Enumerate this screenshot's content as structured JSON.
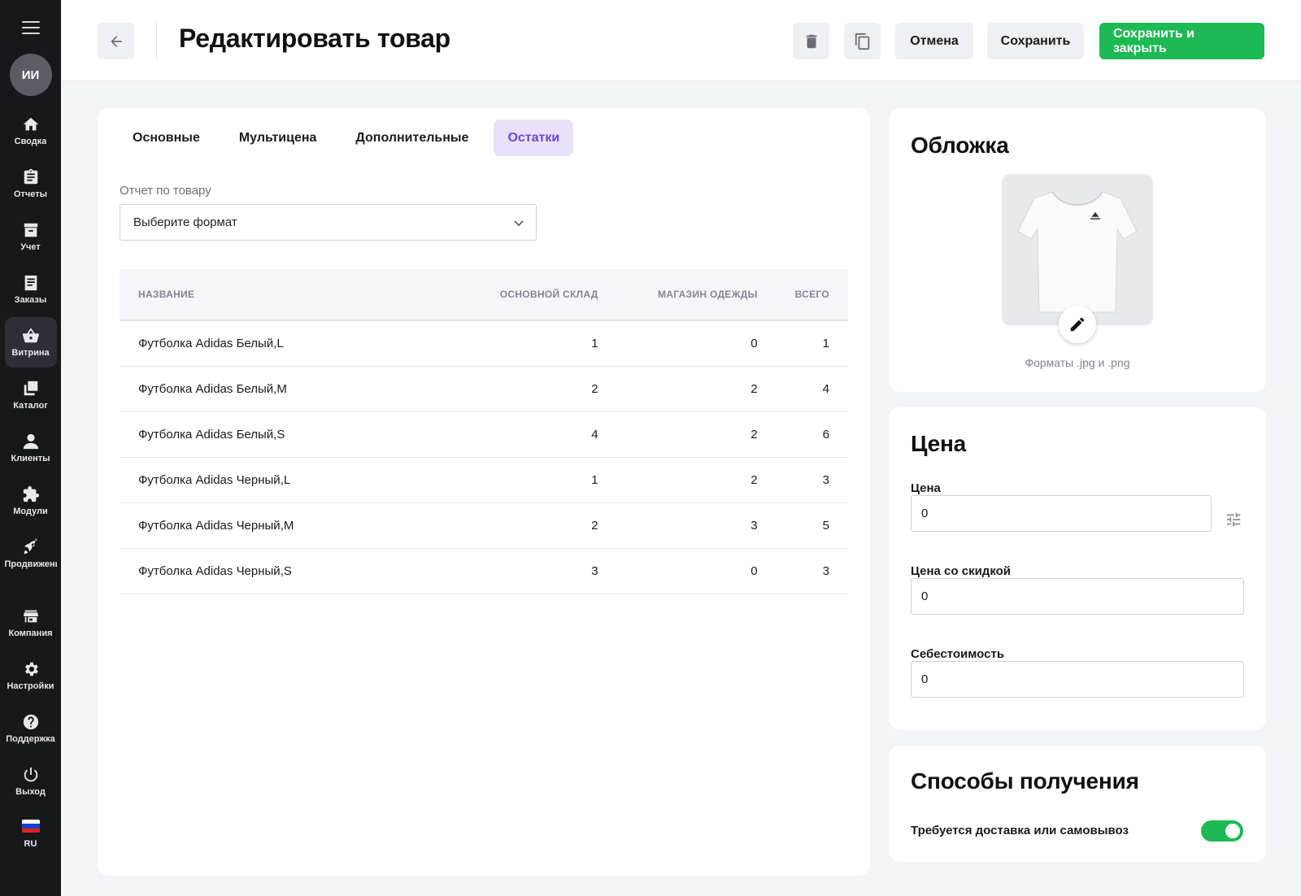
{
  "sidebar": {
    "avatar": "ИИ",
    "items": [
      {
        "label": "Сводка",
        "icon": "home-icon"
      },
      {
        "label": "Отчеты",
        "icon": "clipboard-icon"
      },
      {
        "label": "Учет",
        "icon": "archive-icon"
      },
      {
        "label": "Заказы",
        "icon": "receipt-icon"
      },
      {
        "label": "Витрина",
        "icon": "basket-icon",
        "active": true
      },
      {
        "label": "Каталог",
        "icon": "copy-icon"
      },
      {
        "label": "Клиенты",
        "icon": "person-icon"
      },
      {
        "label": "Модули",
        "icon": "puzzle-icon"
      },
      {
        "label": "Продвижение",
        "icon": "rocket-icon"
      },
      {
        "label": "Компания",
        "icon": "store-icon"
      },
      {
        "label": "Настройки",
        "icon": "gear-icon"
      },
      {
        "label": "Поддержка",
        "icon": "help-icon"
      },
      {
        "label": "Выход",
        "icon": "power-icon"
      },
      {
        "label": "RU",
        "icon": "russia-flag-icon"
      }
    ]
  },
  "header": {
    "title": "Редактировать товар",
    "cancel_label": "Отмена",
    "save_label": "Сохранить",
    "save_close_label": "Сохранить и закрыть"
  },
  "tabs": [
    {
      "label": "Основные"
    },
    {
      "label": "Мультицена"
    },
    {
      "label": "Дополнительные"
    },
    {
      "label": "Остатки",
      "active": true
    }
  ],
  "report": {
    "label": "Отчет по товару",
    "select_value": "Выберите формат"
  },
  "stock_table": {
    "columns": [
      "НАЗВАНИЕ",
      "ОСНОВНОЙ СКЛАД",
      "МАГАЗИН ОДЕЖДЫ",
      "ВСЕГО"
    ],
    "rows": [
      [
        "Футболка Adidas Белый,L",
        "1",
        "0",
        "1"
      ],
      [
        "Футболка Adidas Белый,M",
        "2",
        "2",
        "4"
      ],
      [
        "Футболка Adidas Белый,S",
        "4",
        "2",
        "6"
      ],
      [
        "Футболка Adidas Черный,L",
        "1",
        "2",
        "3"
      ],
      [
        "Футболка Adidas Черный,M",
        "2",
        "3",
        "5"
      ],
      [
        "Футболка Adidas Черный,S",
        "3",
        "0",
        "3"
      ]
    ]
  },
  "cover": {
    "title": "Обложка",
    "formats": "Форматы .jpg и .png"
  },
  "price": {
    "title": "Цена",
    "price_label": "Цена",
    "price_value": "0",
    "discount_label": "Цена со скидкой",
    "discount_value": "0",
    "cost_label": "Себестоимость",
    "cost_value": "0"
  },
  "delivery": {
    "title": "Способы получения",
    "toggle_label": "Требуется доставка или самовывоз",
    "toggle_on": true
  },
  "colors": {
    "accent_green": "#1db954",
    "active_tab_bg": "#e9e1fb",
    "active_tab_text": "#6c46d8",
    "sidebar_bg": "#17181c"
  }
}
